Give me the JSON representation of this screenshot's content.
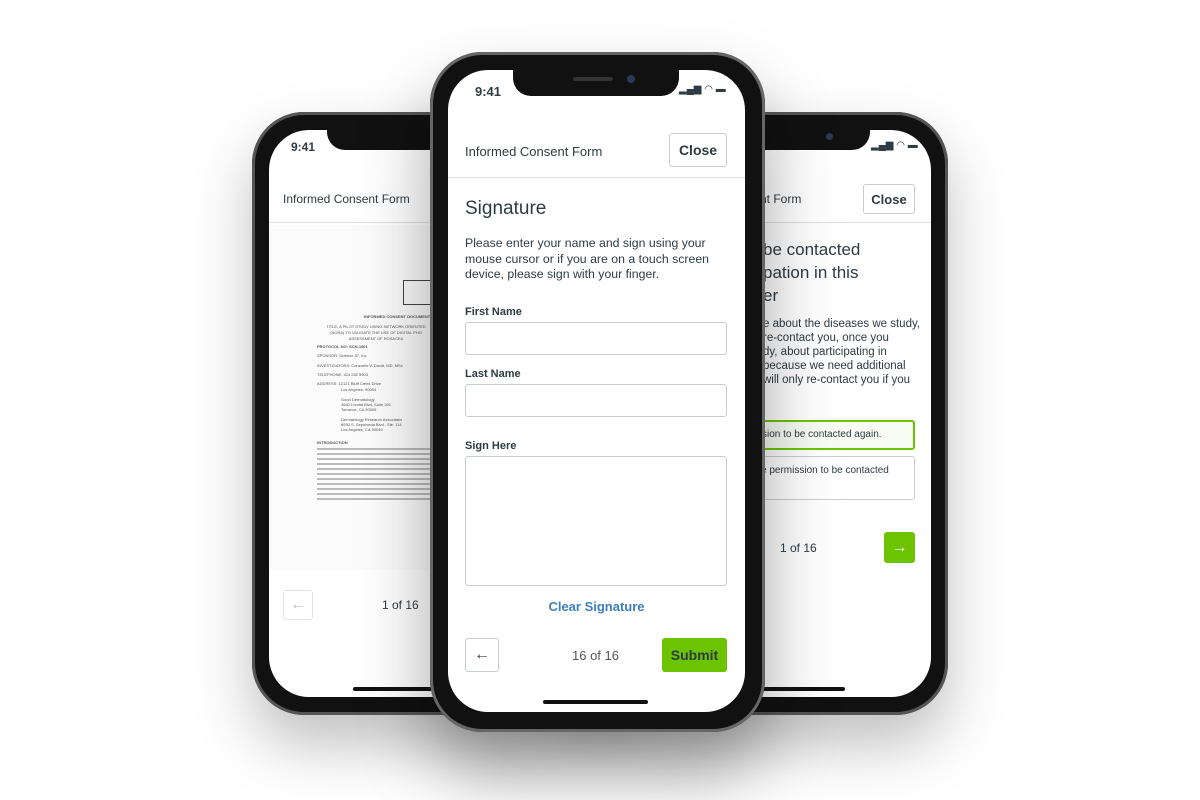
{
  "colors": {
    "accent_green": "#6cc400",
    "link_blue": "#3d7ebf",
    "text": "#2d3b45"
  },
  "left_phone": {
    "time": "9:41",
    "header_title": "Informed Consent Form",
    "pager": "1 of 16",
    "back_icon": "arrow-left-icon",
    "document": {
      "title": "INFORMED CONSENT DOCUMENT",
      "study_title": "TITLE: A PILOT STUDY USING NETWORK ORIENTED (NORA) TO VALIDATE THE USE OF DIGITAL PHO ASSESSMENT OF ROSACEA",
      "protocol": "PROTOCOL NO: SCN-1801",
      "sponsor": "SPONSOR: Science 37, Inc",
      "investigators": "INVESTIGATORS: Consuelo V. David, MD, MSc",
      "telephone": "TELEPHONE: 424 282 5903",
      "address": [
        "ADDRESS: 12121 Bluff Creek Drive",
        "Los Angeles, 90094",
        "Good Dermatology",
        "3640 Lomita Blvd, Suite 301",
        "Torrance, CA 90505",
        "Dermatology Research Associates",
        "8930 S. Sepulveda Blvd., Ste. 114",
        "Los Angeles, CA 90045"
      ],
      "intro_heading": "INTRODUCTION"
    }
  },
  "center_phone": {
    "time": "9:41",
    "header_title": "Informed Consent Form",
    "close_label": "Close",
    "heading": "Signature",
    "instructions": [
      "Please enter your name and sign using your",
      "mouse cursor or if you are on a touch screen",
      "device, please sign with your finger."
    ],
    "first_name_label": "First Name",
    "first_name_value": "",
    "last_name_label": "Last Name",
    "last_name_value": "",
    "sign_label": "Sign Here",
    "clear_signature": "Clear Signature",
    "back_icon": "arrow-left-icon",
    "pager": "16 of 16",
    "submit_label": "Submit"
  },
  "right_phone": {
    "header_title": "nt Form",
    "close_label": "Close",
    "heading_lines": [
      "be contacted",
      "pation in this",
      "er"
    ],
    "body_lines": [
      "e about the diseases we study,",
      "re-contact you, once you",
      "dy, about participating in",
      "because we need additional",
      "will only re-contact you if you"
    ],
    "option_yes": "sion to be contacted again.",
    "option_no": "e permission to be contacted",
    "pager": "1 of 16",
    "next_icon": "arrow-right-icon"
  }
}
